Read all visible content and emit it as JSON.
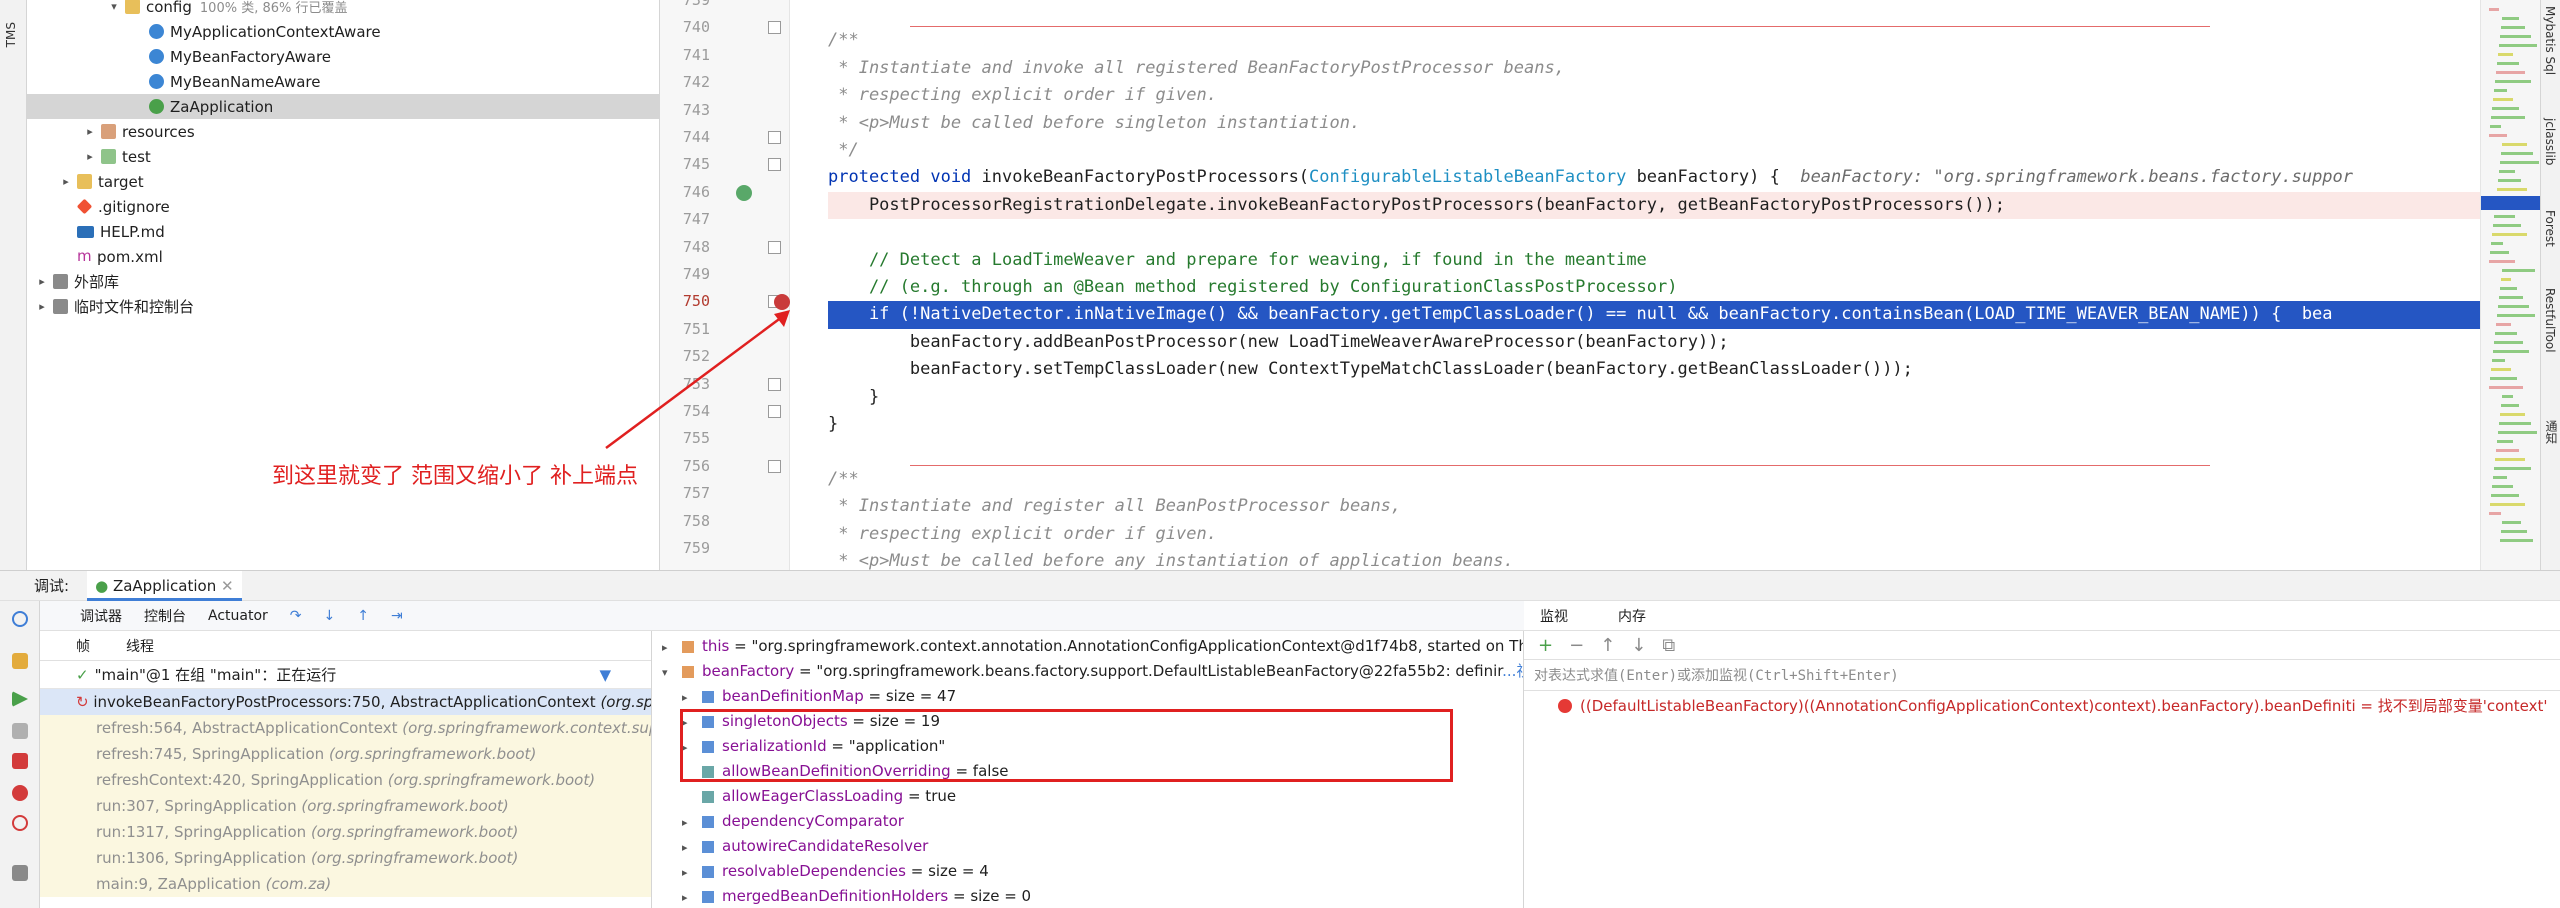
{
  "left_stripe": {
    "label": "TMS"
  },
  "tree": {
    "items": [
      {
        "label": "config",
        "extra": "100% 类, 86% 行已覆盖",
        "icon": "folder-icon",
        "indent": 2
      },
      {
        "label": "MyApplicationContextAware",
        "icon": "class-icon",
        "indent": 3
      },
      {
        "label": "MyBeanFactoryAware",
        "icon": "class-icon",
        "indent": 3
      },
      {
        "label": "MyBeanNameAware",
        "icon": "class-icon",
        "indent": 3
      },
      {
        "label": "ZaApplication",
        "icon": "spring-boot-icon",
        "indent": 3
      },
      {
        "label": "resources",
        "icon": "resources-folder-icon",
        "indent": 1
      },
      {
        "label": "test",
        "icon": "test-folder-icon",
        "indent": 1
      },
      {
        "label": "target",
        "icon": "target-folder-icon",
        "indent": 0
      },
      {
        "label": ".gitignore",
        "icon": "git-icon",
        "indent": 0
      },
      {
        "label": "HELP.md",
        "icon": "markdown-icon",
        "indent": 0
      },
      {
        "label": "pom.xml",
        "icon": "maven-icon",
        "indent": 0
      },
      {
        "label": "外部库",
        "icon": "library-icon",
        "indent": -1
      },
      {
        "label": "临时文件和控制台",
        "icon": "scratch-icon",
        "indent": -1
      }
    ]
  },
  "editor": {
    "line_numbers": [
      "739",
      "740",
      "741",
      "742",
      "743",
      "744",
      "745",
      "746",
      "747",
      "748",
      "749",
      "750",
      "751",
      "752",
      "753",
      "754",
      "755",
      "756",
      "757",
      "758",
      "759"
    ],
    "current_line": "750",
    "lines": {
      "l740": "/**",
      "l741": " * Instantiate and invoke all registered BeanFactoryPostProcessor beans,",
      "l742": " * respecting explicit order if given.",
      "l743": " * <p>Must be called before singleton instantiation.",
      "l744": " */",
      "l745_kw": "protected void ",
      "l745_name": "invokeBeanFactoryPostProcessors(",
      "l745_type": "ConfigurableListableBeanFactory",
      "l745_rest": " beanFactory) {  ",
      "l745_hint": "beanFactory: \"org.springframework.beans.factory.suppor",
      "l746": "    PostProcessorRegistrationDelegate.invokeBeanFactoryPostProcessors(beanFactory, getBeanFactoryPostProcessors());",
      "l748": "    // Detect a LoadTimeWeaver and prepare for weaving, if found in the meantime",
      "l749": "    // (e.g. through an @Bean method registered by ConfigurationClassPostProcessor)",
      "l750": "    if (!NativeDetector.inNativeImage() && beanFactory.getTempClassLoader() == null && beanFactory.containsBean(LOAD_TIME_WEAVER_BEAN_NAME)) {  bea",
      "l751": "        beanFactory.addBeanPostProcessor(new LoadTimeWeaverAwareProcessor(beanFactory));",
      "l752": "        beanFactory.setTempClassLoader(new ContextTypeMatchClassLoader(beanFactory.getBeanClassLoader()));",
      "l753": "    }",
      "l754": "}",
      "l756": "/**",
      "l757": " * Instantiate and register all BeanPostProcessor beans,",
      "l758": " * respecting explicit order if given.",
      "l759": " * <p>Must be called before any instantiation of application beans."
    }
  },
  "right_stripe": {
    "labels": [
      "Mybatis Sql",
      "jclasslib",
      "Forest",
      "RestfulTool",
      "通知"
    ]
  },
  "annotation": {
    "text": "到这里就变了 范围又缩小了 补上端点",
    "color": "#e02020"
  },
  "debugger": {
    "title": "调试:",
    "session_tab": "ZaApplication",
    "toolbar": {
      "debugger": "调试器",
      "console": "控制台",
      "actuator": "Actuator"
    },
    "frames_tabs": {
      "frames": "帧",
      "threads": "线程"
    },
    "thread": "\"main\"@1 在组 \"main\"：正在运行",
    "frames": [
      {
        "method": "invokeBeanFactoryPostProcessors:750, AbstractApplicationContext",
        "pkg": "(org.spr"
      },
      {
        "method": "refresh:564, AbstractApplicationContext",
        "pkg": "(org.springframework.context.supp"
      },
      {
        "method": "refresh:745, SpringApplication",
        "pkg": "(org.springframework.boot)"
      },
      {
        "method": "refreshContext:420, SpringApplication",
        "pkg": "(org.springframework.boot)"
      },
      {
        "method": "run:307, SpringApplication",
        "pkg": "(org.springframework.boot)"
      },
      {
        "method": "run:1317, SpringApplication",
        "pkg": "(org.springframework.boot)"
      },
      {
        "method": "run:1306, SpringApplication",
        "pkg": "(org.springframework.boot)"
      },
      {
        "method": "main:9, ZaApplication",
        "pkg": "(com.za)"
      }
    ],
    "variables": [
      {
        "name": "this",
        "value": " = \"org.springframework.context.annotation.AnnotationConfigApplicationContext@d1f74b8, started on Thu",
        "level": 0,
        "exp": "collapsed"
      },
      {
        "name": "beanFactory",
        "value": " = \"org.springframework.beans.factory.support.DefaultListableBeanFactory@22fa55b2: definir",
        "extra": "...视图",
        "level": 0,
        "exp": "expanded"
      },
      {
        "name": "beanDefinitionMap",
        "value": " =  size = 47",
        "level": 1,
        "exp": "collapsed"
      },
      {
        "name": "singletonObjects",
        "value": " =  size = 19",
        "level": 1,
        "exp": "collapsed"
      },
      {
        "name": "serializationId",
        "value": " = \"application\"",
        "level": 1,
        "exp": "collapsed"
      },
      {
        "name": "allowBeanDefinitionOverriding",
        "value": " = false",
        "level": 1,
        "exp": "none"
      },
      {
        "name": "allowEagerClassLoading",
        "value": " = true",
        "level": 1,
        "exp": "none"
      },
      {
        "name": "dependencyComparator",
        "value": "",
        "level": 1,
        "exp": "collapsed"
      },
      {
        "name": "autowireCandidateResolver",
        "value": "",
        "level": 1,
        "exp": "collapsed"
      },
      {
        "name": "resolvableDependencies",
        "value": " =  size = 4",
        "level": 1,
        "exp": "collapsed"
      },
      {
        "name": "mergedBeanDefinitionHolders",
        "value": " =  size = 0",
        "level": 1,
        "exp": "collapsed"
      }
    ],
    "watch_tabs": {
      "watch": "监视",
      "memory": "内存"
    },
    "watch_placeholder": "对表达式求值(Enter)或添加监视(Ctrl+Shift+Enter)",
    "watch_error": "((DefaultListableBeanFactory)((AnnotationConfigApplicationContext)context).beanFactory).beanDefiniti = 找不到局部变量'context'"
  }
}
